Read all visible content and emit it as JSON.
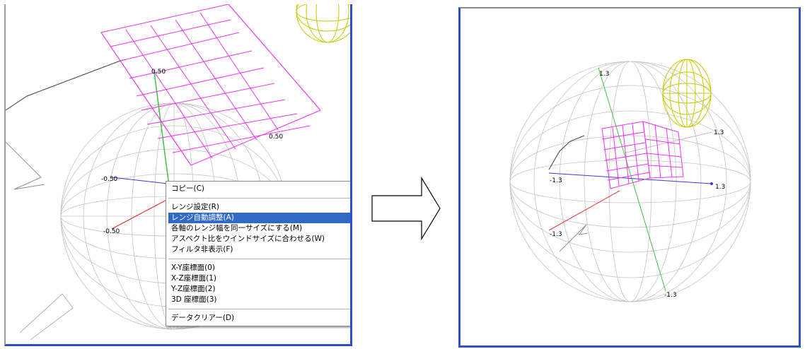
{
  "left": {
    "axis_labels": [
      "-0.50",
      "0.50",
      "-0.50",
      "0.50"
    ],
    "context_menu": {
      "items": [
        {
          "label": "コピー(C)"
        },
        {
          "separator": true
        },
        {
          "label": "レンジ設定(R)"
        },
        {
          "label": "レンジ自動調整(A)",
          "highlighted": true
        },
        {
          "label": "各軸のレンジ幅を同一サイズにする(M)"
        },
        {
          "label": "アスペクト比をウインドサイズに合わせる(W)"
        },
        {
          "label": "フィルタ非表示(F)"
        },
        {
          "separator": true
        },
        {
          "label": "X-Y座標面(0)"
        },
        {
          "label": "X-Z座標面(1)"
        },
        {
          "label": "Y-Z座標面(2)"
        },
        {
          "label": "3D 座標面(3)"
        },
        {
          "separator": true
        },
        {
          "label": "データクリアー(D)"
        }
      ]
    }
  },
  "right": {
    "axis_labels": [
      "1.3",
      "1.3",
      "-1.3",
      "1.3",
      "-1.3",
      "-1.3"
    ]
  },
  "colors": {
    "cube": "#ee33ee",
    "ellipsoid": "#c8c800",
    "sphere_wire": "#c4c4c4",
    "x_axis": "#3a3ad8",
    "y_axis": "#e02020",
    "z_axis": "#40c040",
    "menu_highlight": "#3169c6",
    "window_border": "#3050c8"
  },
  "icons": {
    "transition": "right-arrow-icon"
  }
}
